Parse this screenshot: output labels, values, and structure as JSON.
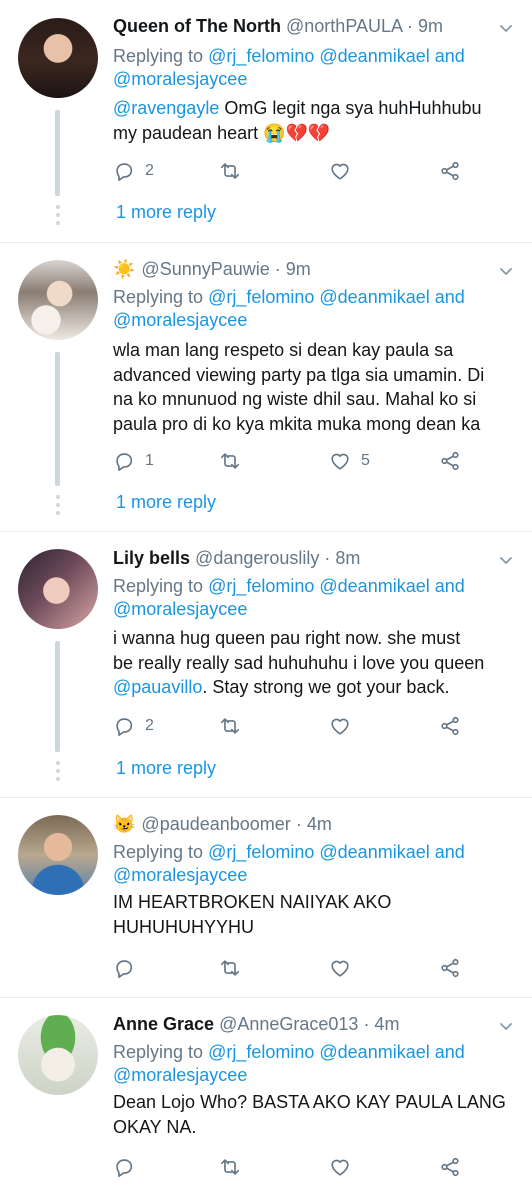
{
  "tweets": [
    {
      "name": "Queen of The North",
      "emoji": "",
      "handle": "@northPAULA",
      "time": "· 9m",
      "reply_prefix": "Replying to ",
      "reply_user1": "@rj_felomino",
      "reply_user2": "@deanmikael",
      "reply_and": "and",
      "reply_user3": "@moralesjaycee",
      "body_mention": "@ravengayle",
      "body_line1_rest": " OmG legit nga sya huhHuhhubu",
      "body_line2": "my paudean heart 😭💔💔",
      "reply_count": "2",
      "retweet_count": "",
      "like_count": "",
      "more_reply": "1 more reply"
    },
    {
      "name": "",
      "emoji": "☀️",
      "handle": "@SunnyPauwie",
      "time": "· 9m",
      "reply_prefix": "Replying to ",
      "reply_user1": "@rj_felomino",
      "reply_user2": "@deanmikael",
      "reply_and": "and",
      "reply_user3": "@moralesjaycee",
      "body_lines": [
        "wla man lang respeto si dean kay paula sa",
        "advanced viewing party pa tlga sia umamin. Di",
        "na ko mnunuod ng wiste dhil sau. Mahal ko si",
        "paula pro di ko kya mkita muka mong dean ka"
      ],
      "reply_count": "1",
      "retweet_count": "",
      "like_count": "5",
      "more_reply": "1 more reply"
    },
    {
      "name": "Lily bells",
      "emoji": "",
      "handle": "@dangerouslily",
      "time": "· 8m",
      "reply_prefix": "Replying to ",
      "reply_user1": "@rj_felomino",
      "reply_user2": "@deanmikael",
      "reply_and": "and",
      "reply_user3": "@moralesjaycee",
      "body_line1": "i wanna hug queen pau right now. she must",
      "body_line2": "be really really sad huhuhuhu i love you queen",
      "body_mention": "@pauavillo",
      "body_line3_rest": ". Stay strong we got your back.",
      "reply_count": "2",
      "retweet_count": "",
      "like_count": "",
      "more_reply": "1 more reply"
    },
    {
      "name": "",
      "emoji": "😼",
      "handle": "@paudeanboomer",
      "time": "· 4m",
      "reply_prefix": "Replying to ",
      "reply_user1": "@rj_felomino",
      "reply_user2": "@deanmikael",
      "reply_and": "and",
      "reply_user3": "@moralesjaycee",
      "body_lines": [
        "IM HEARTBROKEN NAIIYAK AKO",
        "HUHUHUHYYHU"
      ],
      "reply_count": "",
      "retweet_count": "",
      "like_count": ""
    },
    {
      "name": "Anne Grace",
      "emoji": "",
      "handle": "@AnneGrace013",
      "time": "· 4m",
      "reply_prefix": "Replying to ",
      "reply_user1": "@rj_felomino",
      "reply_user2": "@deanmikael",
      "reply_and": "and",
      "reply_user3": "@moralesjaycee",
      "body_lines": [
        "Dean Lojo Who? BASTA AKO KAY PAULA LANG",
        "OKAY NA."
      ],
      "reply_count": "",
      "retweet_count": "",
      "like_count": ""
    }
  ],
  "colors": {
    "link": "#1b95e0",
    "muted": "#657786",
    "text": "#14171a",
    "thread": "#ccd6dd",
    "divider": "#e6ecf0"
  },
  "icons": [
    "reply-icon",
    "retweet-icon",
    "like-icon",
    "share-icon",
    "chevron-down-icon"
  ]
}
